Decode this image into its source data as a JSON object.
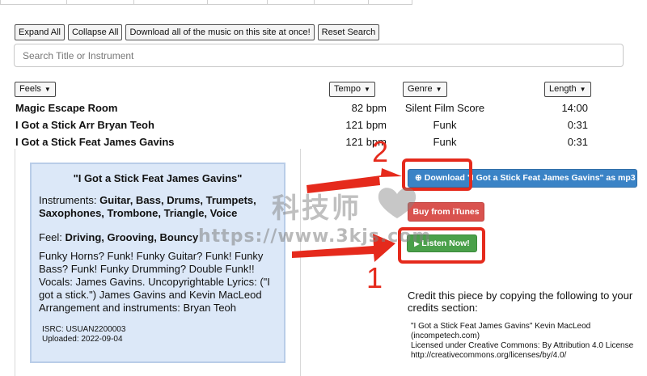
{
  "toolbar": {
    "expand_all": "Expand All",
    "collapse_all": "Collapse All",
    "download_all": "Download all of the music on this site at once!",
    "reset_search": "Reset Search"
  },
  "search": {
    "placeholder": "Search Title or Instrument",
    "value": ""
  },
  "filters": {
    "feels": "Feels",
    "tempo": "Tempo",
    "genre": "Genre",
    "length": "Length"
  },
  "tracks": [
    {
      "title": "Magic Escape Room",
      "tempo": "82 bpm",
      "genre": "Silent Film Score",
      "length": "14:00"
    },
    {
      "title": "I Got a Stick Arr Bryan Teoh",
      "tempo": "121 bpm",
      "genre": "Funk",
      "length": "0:31"
    },
    {
      "title": "I Got a Stick Feat James Gavins",
      "tempo": "121 bpm",
      "genre": "Funk",
      "length": "0:31"
    }
  ],
  "detail": {
    "title": "\"I Got a Stick Feat James Gavins\"",
    "instruments_label": "Instruments: ",
    "instruments": "Guitar, Bass, Drums, Trumpets, Saxophones, Trombone, Triangle, Voice",
    "feel_label": "Feel: ",
    "feel": "Driving, Grooving, Bouncy",
    "description": "Funky Horns? Funk! Funky Guitar? Funk! Funky Bass? Funk! Funky Drumming? Double Funk!! Vocals: James Gavins. Uncopyrightable Lyrics: (\"I got a stick.\") James Gavins and Kevin MacLeod Arrangement and instruments: Bryan Teoh",
    "isrc": "ISRC: USUAN2200003",
    "uploaded": "Uploaded: 2022-09-04"
  },
  "actions": {
    "download": "Download \"I Got a Stick Feat James Gavins\" as mp3",
    "itunes": "Buy from iTunes",
    "listen": "Listen Now!"
  },
  "credit": {
    "heading": "Credit this piece by copying the following to your credits section:",
    "line1": "\"I Got a Stick Feat James Gavins\" Kevin MacLeod (incompetech.com)",
    "line2": "Licensed under Creative Commons: By Attribution 4.0 License",
    "line3": "http://creativecommons.org/licenses/by/4.0/"
  },
  "annotations": {
    "one": "1",
    "two": "2"
  },
  "watermark": {
    "logo": "科技师",
    "url": "https://www.3kjs.com"
  },
  "colors": {
    "download_blue": "#3a83c6",
    "itunes_red": "#d9534f",
    "listen_green": "#4aa04a",
    "annotation_red": "#e52a1c",
    "panel_blue": "#dce8f8"
  }
}
